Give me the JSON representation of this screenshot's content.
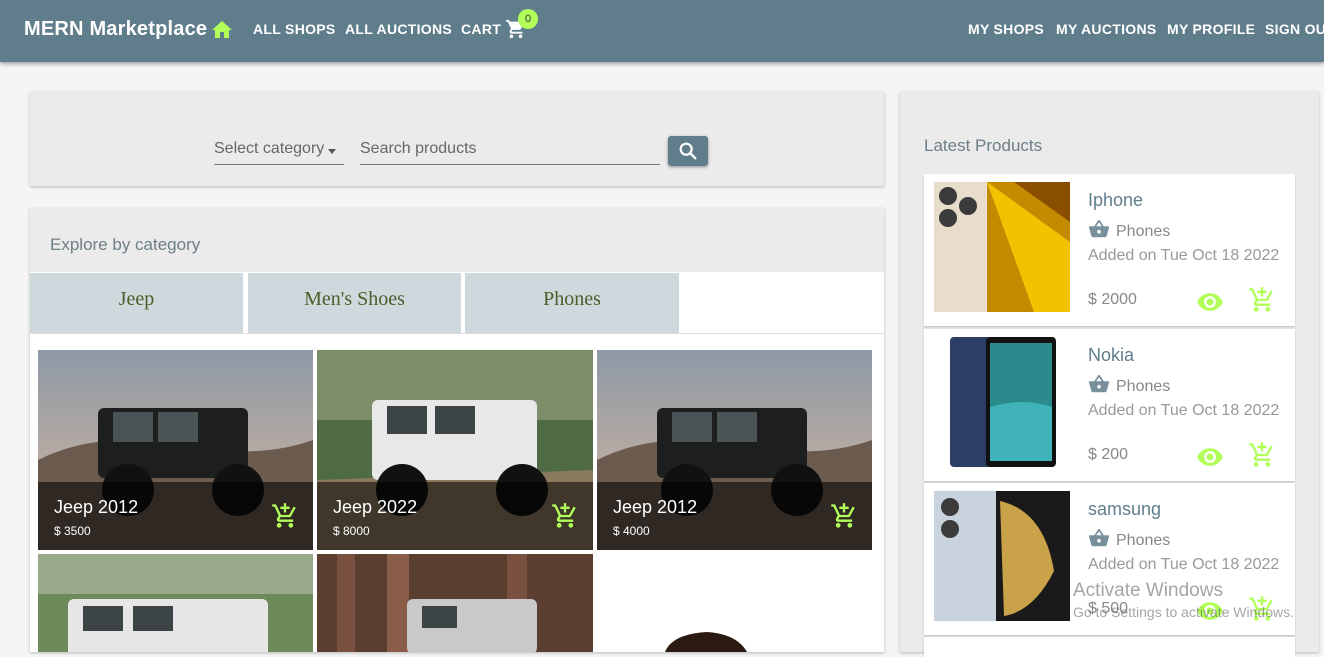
{
  "appbar": {
    "brand": "MERN Marketplace",
    "links": [
      "ALL SHOPS",
      "ALL AUCTIONS",
      "CART"
    ],
    "cart_count": "0",
    "right_links": [
      "MY SHOPS",
      "MY AUCTIONS",
      "MY PROFILE",
      "SIGN OUT"
    ]
  },
  "search": {
    "category_label": "Select category",
    "placeholder": "Search products"
  },
  "explore": {
    "title": "Explore by category",
    "tabs": [
      "Jeep",
      "Men's Shoes",
      "Phones"
    ],
    "tiles": [
      {
        "name": "Jeep 2012",
        "price": "$ 3500"
      },
      {
        "name": "Jeep 2022",
        "price": "$ 8000"
      },
      {
        "name": "Jeep 2012",
        "price": "$ 4000"
      }
    ]
  },
  "latest": {
    "title": "Latest Products",
    "products": [
      {
        "name": "Iphone",
        "category": "Phones",
        "date": "Added on Tue Oct 18 2022",
        "price": "$ 2000"
      },
      {
        "name": "Nokia",
        "category": "Phones",
        "date": "Added on Tue Oct 18 2022",
        "price": "$ 200"
      },
      {
        "name": "samsung",
        "category": "Phones",
        "date": "Added on Tue Oct 18 2022",
        "price": "$ 500"
      }
    ]
  },
  "watermark": {
    "line1": "Activate Windows",
    "line2": "Go to Settings to activate Windows."
  },
  "colors": {
    "appbar": "#607d8b",
    "accent": "#b2ff59",
    "tab_bg": "#cfd8dc"
  }
}
